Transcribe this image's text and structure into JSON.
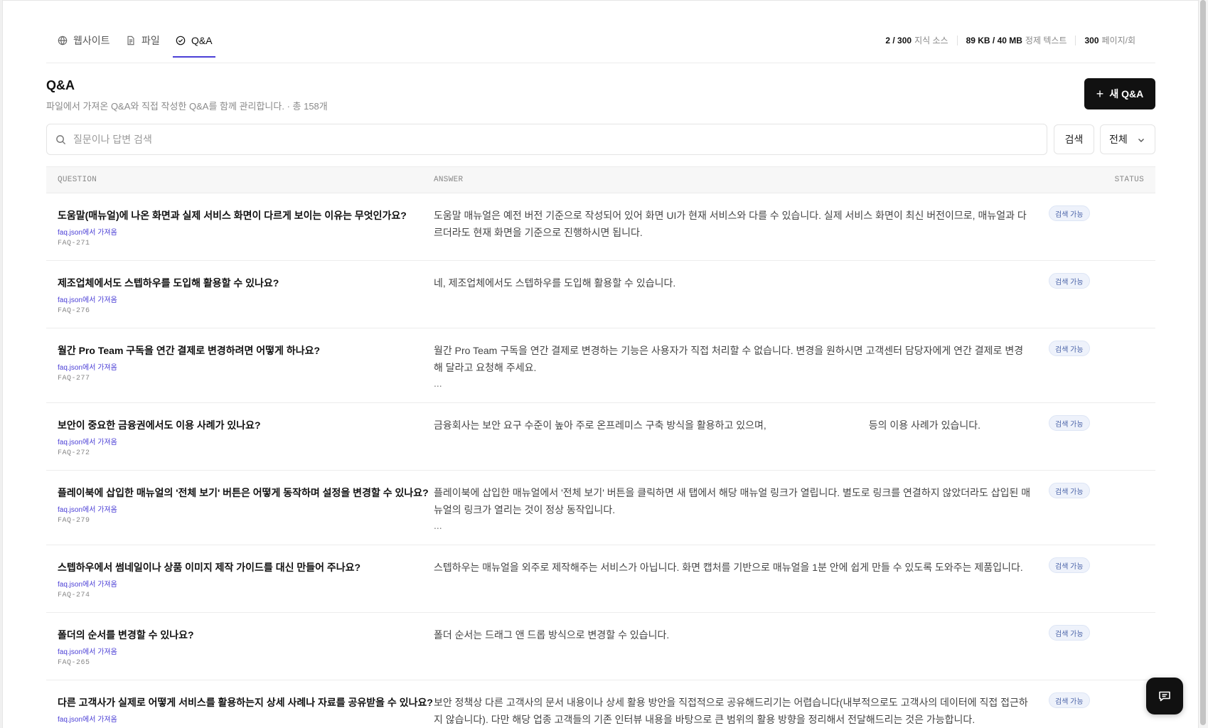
{
  "tabs": [
    {
      "label": "웹사이트",
      "icon": "globe-icon"
    },
    {
      "label": "파일",
      "icon": "file-icon"
    },
    {
      "label": "Q&A",
      "icon": "check-circle-icon",
      "active": true
    }
  ],
  "stats": [
    {
      "value": "2 / 300",
      "label": "지식 소스"
    },
    {
      "value": "89 KB / 40 MB",
      "label": "정제 텍스트"
    },
    {
      "value": "300",
      "label": "페이지/회"
    }
  ],
  "page": {
    "title": "Q&A",
    "subtitle": "파일에서 가져온 Q&A와 직접 작성한 Q&A를 함께 관리합니다. · 총 158개",
    "new_button": "새 Q&A"
  },
  "search": {
    "placeholder": "질문이나 답변 검색",
    "button": "검색",
    "filter": "전체"
  },
  "table": {
    "headers": {
      "question": "QUESTION",
      "answer": "ANSWER",
      "status": "STATUS"
    },
    "rows": [
      {
        "question": "도움말(매뉴얼)에 나온 화면과 실제 서비스 화면이 다르게 보이는 이유는 무엇인가요?",
        "source": "faq.json에서 가져옴",
        "id": "FAQ-271",
        "answer": "도움말 매뉴얼은 예전 버전 기준으로 작성되어 있어 화면 UI가 현재 서비스와 다를 수 있습니다. 실제 서비스 화면이 최신 버전이므로, 매뉴얼과 다르더라도 현재 화면을 기준으로 진행하시면 됩니다.",
        "truncated": "",
        "status": "검색 가능"
      },
      {
        "question": "제조업체에서도 스텝하우를 도입해 활용할 수 있나요?",
        "source": "faq.json에서 가져옴",
        "id": "FAQ-276",
        "answer": "네, 제조업체에서도 스텝하우를 도입해 활용할 수 있습니다.",
        "truncated": "",
        "status": "검색 가능"
      },
      {
        "question": "월간 Pro Team 구독을 연간 결제로 변경하려면 어떻게 하나요?",
        "source": "faq.json에서 가져옴",
        "id": "FAQ-277",
        "answer": "월간 Pro Team 구독을 연간 결제로 변경하는 기능은 사용자가 직접 처리할 수 없습니다. 변경을 원하시면 고객센터 담당자에게 연간 결제로 변경해 달라고 요청해 주세요.",
        "truncated": "...",
        "status": "검색 가능"
      },
      {
        "question": "보안이 중요한 금융권에서도 이용 사례가 있나요?",
        "source": "faq.json에서 가져옴",
        "id": "FAQ-272",
        "answer": "금융회사는 보안 요구 수준이 높아 주로 온프레미스 구축 방식을 활용하고 있으며,                                     등의 이용 사례가 있습니다.",
        "truncated": "",
        "status": "검색 가능"
      },
      {
        "question": "플레이북에 삽입한 매뉴얼의 '전체 보기' 버튼은 어떻게 동작하며 설정을 변경할 수 있나요?",
        "source": "faq.json에서 가져옴",
        "id": "FAQ-279",
        "answer": "플레이북에 삽입한 매뉴얼에서 '전체 보기' 버튼을 클릭하면 새 탭에서 해당 매뉴얼 링크가 열립니다. 별도로 링크를 연결하지 않았더라도 삽입된 매뉴얼의 링크가 열리는 것이 정상 동작입니다.",
        "truncated": "...",
        "status": "검색 가능"
      },
      {
        "question": "스텝하우에서 썸네일이나 상품 이미지 제작 가이드를 대신 만들어 주나요?",
        "source": "faq.json에서 가져옴",
        "id": "FAQ-274",
        "answer": "스텝하우는 매뉴얼을 외주로 제작해주는 서비스가 아닙니다. 화면 캡처를 기반으로 매뉴얼을 1분 안에 쉽게 만들 수 있도록 도와주는 제품입니다.",
        "truncated": "",
        "status": "검색 가능"
      },
      {
        "question": "폴더의 순서를 변경할 수 있나요?",
        "source": "faq.json에서 가져옴",
        "id": "FAQ-265",
        "answer": "폴더 순서는 드래그 앤 드롭 방식으로 변경할 수 있습니다.",
        "truncated": "",
        "status": "검색 가능"
      },
      {
        "question": "다른 고객사가 실제로 어떻게 서비스를 활용하는지 상세 사례나 자료를 공유받을 수 있나요?",
        "source": "faq.json에서 가져옴",
        "id": "",
        "answer": "보안 정책상 다른 고객사의 문서 내용이나 상세 활용 방안을 직접적으로 공유해드리기는 어렵습니다(내부적으로도 고객사의 데이터에 직접 접근하지 않습니다). 다만 해당 업종 고객들의 기존 인터뷰 내용을 바탕으로 큰 범위의 활용 방향을 정리해서 전달해드리는 것은 가능합니다.",
        "truncated": "",
        "status": "검색 가능"
      }
    ]
  },
  "colors": {
    "accent": "#4b3fd6",
    "primary_button": "#111111",
    "badge_bg": "#eef2fb",
    "badge_text": "#4a63a8"
  }
}
